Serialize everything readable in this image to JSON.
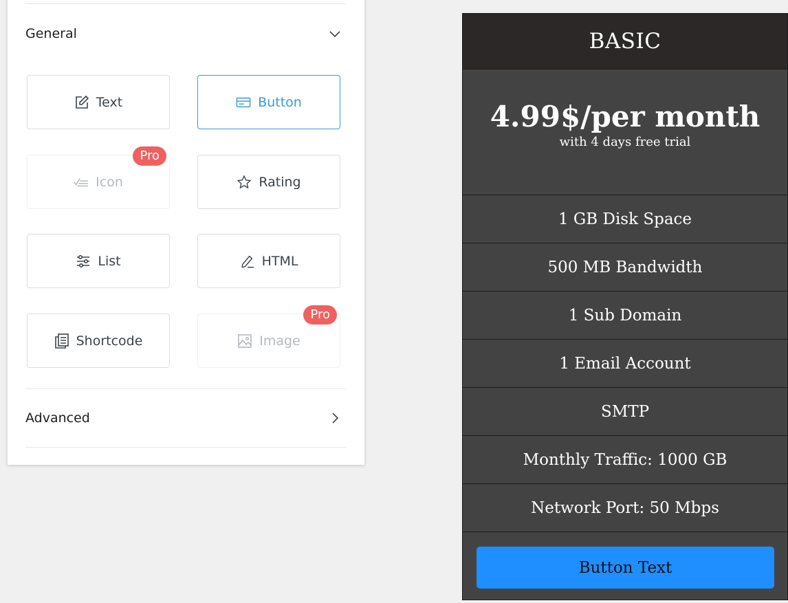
{
  "sidebar": {
    "general_label": "General",
    "advanced_label": "Advanced",
    "widgets": [
      {
        "label": "Text",
        "icon": "edit-icon",
        "state": "normal"
      },
      {
        "label": "Button",
        "icon": "button-icon",
        "state": "active"
      },
      {
        "label": "Icon",
        "icon": "checklist-icon",
        "state": "disabled",
        "badge": "Pro"
      },
      {
        "label": "Rating",
        "icon": "star-icon",
        "state": "normal"
      },
      {
        "label": "List",
        "icon": "sliders-icon",
        "state": "normal"
      },
      {
        "label": "HTML",
        "icon": "pen-icon",
        "state": "normal"
      },
      {
        "label": "Shortcode",
        "icon": "shortcode-icon",
        "state": "normal"
      },
      {
        "label": "Image",
        "icon": "image-icon",
        "state": "disabled",
        "badge": "Pro"
      }
    ]
  },
  "pricing": {
    "title": "BASIC",
    "price": "4.99$/per month",
    "subtitle": "with 4 days free trial",
    "features": [
      "1 GB Disk Space",
      "500 MB Bandwidth",
      "1 Sub Domain",
      "1 Email Account",
      "SMTP",
      "Monthly Traffic: 1000 GB",
      "Network Port: 50 Mbps"
    ],
    "button_label": "Button Text"
  },
  "colors": {
    "accent": "#3a9bd9",
    "pro_badge": "#f16060",
    "pricing_bg": "#444344",
    "pricing_header_bg": "#2c2828",
    "pricing_button": "#1f8eff"
  }
}
